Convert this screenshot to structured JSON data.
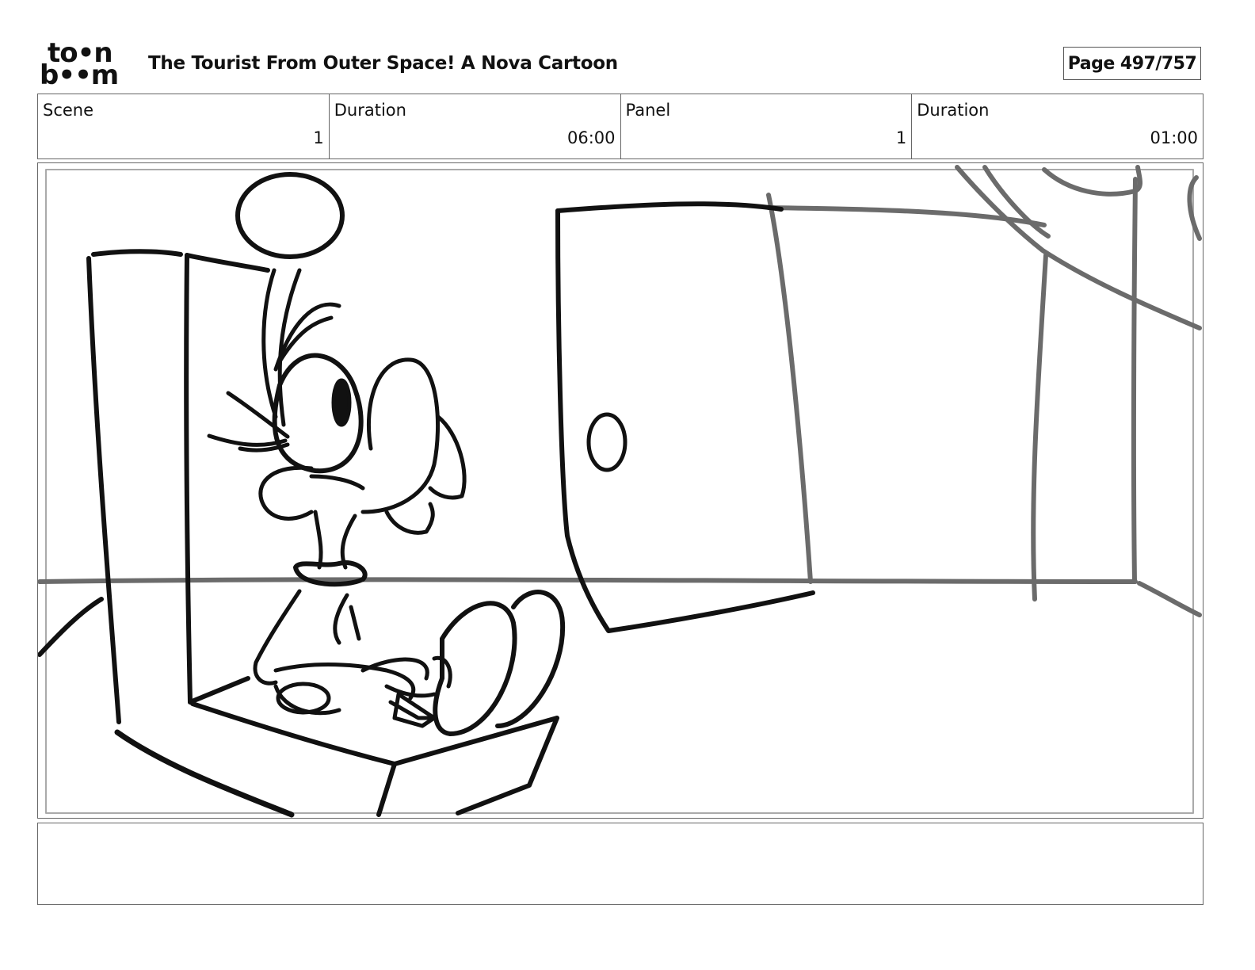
{
  "header": {
    "logo_line1": "to•n",
    "logo_line2": "b••m",
    "title": "The Tourist From Outer Space!  A Nova Cartoon",
    "page_label": "Page 497/757"
  },
  "info": {
    "scene_label": "Scene",
    "scene_value": "1",
    "scene_duration_label": "Duration",
    "scene_duration_value": "06:00",
    "panel_label": "Panel",
    "panel_value": "1",
    "panel_duration_label": "Duration",
    "panel_duration_value": "01:00"
  },
  "notes": {
    "text": ""
  }
}
